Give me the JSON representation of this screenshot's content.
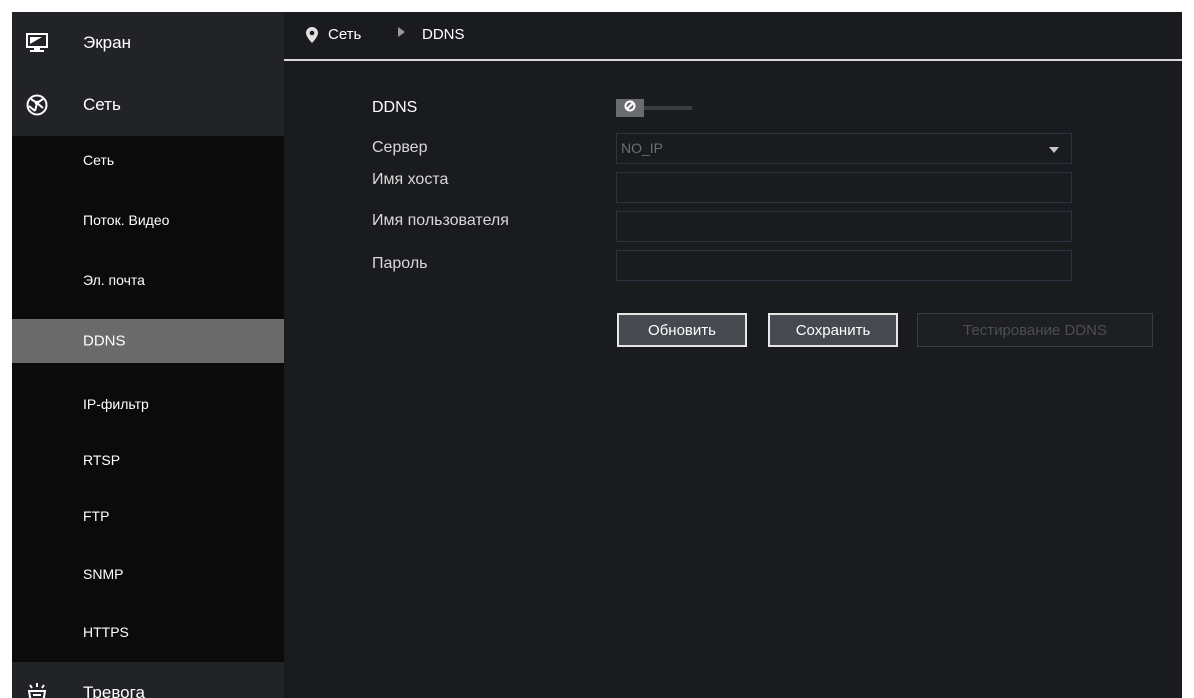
{
  "sidebar": {
    "top_items": [
      {
        "label": "Экран",
        "icon": "monitor-icon"
      },
      {
        "label": "Сеть",
        "icon": "globe-icon"
      },
      {
        "label": "Тревога",
        "icon": "alarm-icon"
      }
    ],
    "sub_items": [
      {
        "label": "Сеть"
      },
      {
        "label": "Поток. Видео"
      },
      {
        "label": "Эл. почта"
      },
      {
        "label": "DDNS",
        "active": true
      },
      {
        "label": "IP-фильтр"
      },
      {
        "label": "RTSP"
      },
      {
        "label": "FTP"
      },
      {
        "label": "SNMP"
      },
      {
        "label": "HTTPS"
      }
    ]
  },
  "breadcrumb": {
    "icon": "location-pin-icon",
    "parent": "Сеть",
    "separator_icon": "triangle-right-icon",
    "current": "DDNS"
  },
  "form": {
    "ddns_label": "DDNS",
    "ddns_enabled": false,
    "server_label": "Сервер",
    "server_value": "NO_IP",
    "hostname_label": "Имя хоста",
    "hostname_value": "",
    "username_label": "Имя пользователя",
    "username_value": "",
    "password_label": "Пароль",
    "password_value": ""
  },
  "buttons": {
    "refresh": "Обновить",
    "save": "Сохранить",
    "test": "Тестирование DDNS"
  },
  "colors": {
    "background": "#1a1b1e",
    "sidebar": "#0b0b0c",
    "sidebar_top": "#222327",
    "active_item": "#6a6a6a",
    "input_border": "#2b3442"
  }
}
